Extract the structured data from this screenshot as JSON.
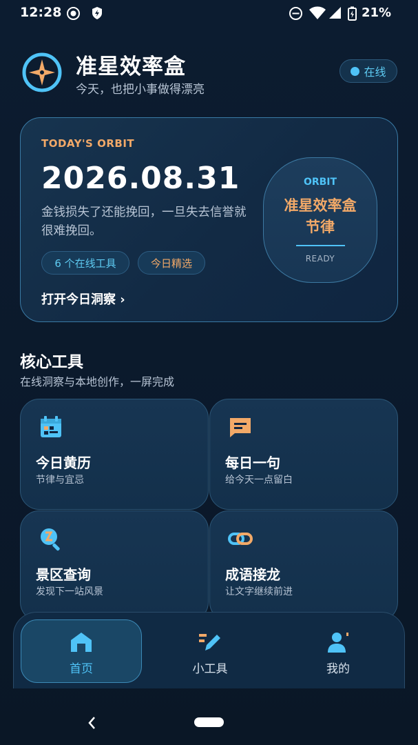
{
  "status_bar": {
    "time": "12:28",
    "battery": "21%",
    "icons": [
      "record-icon",
      "shield-icon",
      "do-not-disturb-icon",
      "wifi-icon",
      "cellular-signal-icon",
      "battery-charging-icon"
    ]
  },
  "header": {
    "title": "准星效率盒",
    "subtitle": "今天，也把小事做得漂亮",
    "status": "在线",
    "logo_icon": "compass-star-icon"
  },
  "hero": {
    "kicker": "TODAY'S ORBIT",
    "date": "2026.08.31",
    "quote": "金钱损失了还能挽回，一旦失去信誉就很难挽回。",
    "chips": [
      "6 个在线工具",
      "今日精选"
    ],
    "link": "打开今日洞察 ›",
    "badge": {
      "label": "ORBIT",
      "name": "准星效率盒",
      "keyword": "节律",
      "status": "READY"
    }
  },
  "section": {
    "title": "核心工具",
    "subtitle": "在线洞察与本地创作，一屏完成"
  },
  "tools": [
    {
      "title": "今日黄历",
      "subtitle": "节律与宜忌",
      "icon": "calendar-icon"
    },
    {
      "title": "每日一句",
      "subtitle": "给今天一点留白",
      "icon": "message-icon"
    },
    {
      "title": "景区查询",
      "subtitle": "发现下一站风景",
      "icon": "search-icon"
    },
    {
      "title": "成语接龙",
      "subtitle": "让文字继续前进",
      "icon": "link-icon"
    }
  ],
  "bottom_nav": {
    "items": [
      {
        "label": "首页",
        "icon": "home-icon",
        "active": true
      },
      {
        "label": "小工具",
        "icon": "edit-icon",
        "active": false
      },
      {
        "label": "我的",
        "icon": "user-icon",
        "active": false
      }
    ]
  },
  "colors": {
    "background": "#0b1a2c",
    "accent_blue": "#4fc3f7",
    "accent_orange": "#f2a968",
    "card": "#13304b"
  }
}
